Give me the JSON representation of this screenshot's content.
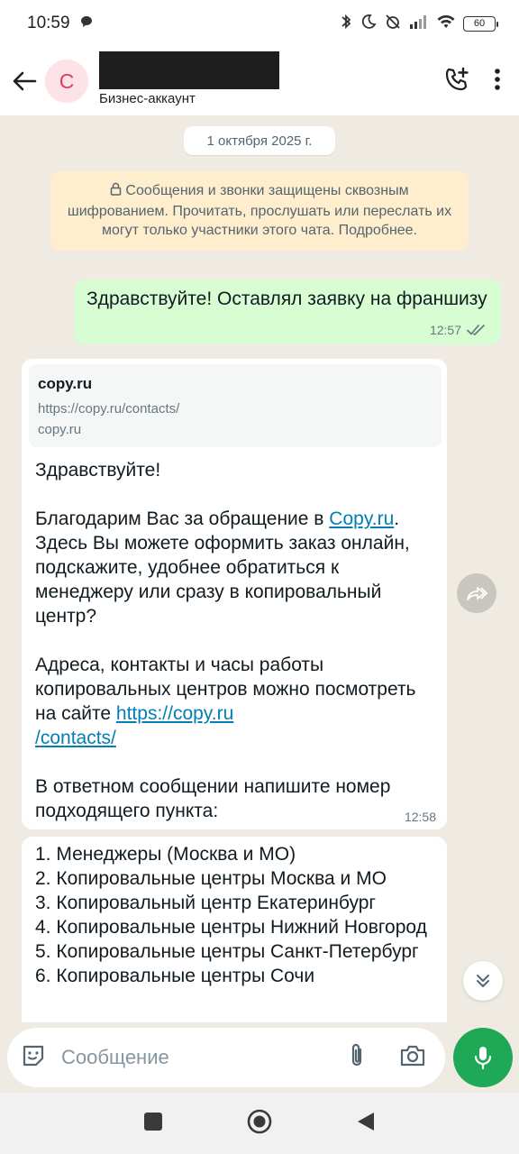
{
  "status_bar": {
    "time": "10:59",
    "battery": "60"
  },
  "header": {
    "avatar_initial": "C",
    "subtitle": "Бизнес-аккаунт"
  },
  "chat": {
    "date_chip": "1 октября 2025 г.",
    "encryption_notice": "Сообщения и звонки защищены сквозным шифрованием. Прочитать, прослушать или переслать их могут только участники этого чата. Подробнее.",
    "outgoing": {
      "text": "Здравствуйте! Оставлял заявку на франшизу",
      "time": "12:57"
    },
    "incoming_1": {
      "preview_title": "copy.ru",
      "preview_url": "https://copy.ru/contacts/",
      "preview_domain": "copy.ru",
      "greeting": "Здравствуйте!",
      "p2_before": "Благодарим Вас за обращение в ",
      "p2_link": "Copy.ru",
      "p2_after": ". Здесь Вы можете оформить заказ онлайн, подскажите, удобнее обратиться к менеджеру или сразу в копировальный центр?",
      "p3_before": "Адреса, контакты и часы работы копировальных центров можно посмотреть на сайте ",
      "p3_link_a": "https://copy.ru",
      "p3_link_b": "/contacts/",
      "p4": "В ответном сообщении напишите номер подходящего пункта:",
      "time": "12:58"
    },
    "incoming_2": {
      "lines": [
        "1. Менеджеры (Москва и МО)",
        "2. Копировальные центры Москва и МО",
        "3. Копировальный центр Екатеринбург",
        "4. Копировальные центры Нижний Новгород",
        "5. Копировальные центры Санкт-Петербург",
        "6. Копировальные центры Сочи"
      ]
    }
  },
  "composer": {
    "placeholder": "Сообщение"
  },
  "colors": {
    "outgoing_bubble": "#d9fdd3",
    "notice_bg": "#ffeecd",
    "accent_green": "#1fa855",
    "link": "#027eb5"
  },
  "icons": [
    "back-arrow-icon",
    "add-call-icon",
    "more-vert-icon",
    "lock-icon",
    "double-check-icon",
    "forward-icon",
    "scroll-down-icon",
    "sticker-icon",
    "attach-icon",
    "camera-icon",
    "mic-icon"
  ]
}
